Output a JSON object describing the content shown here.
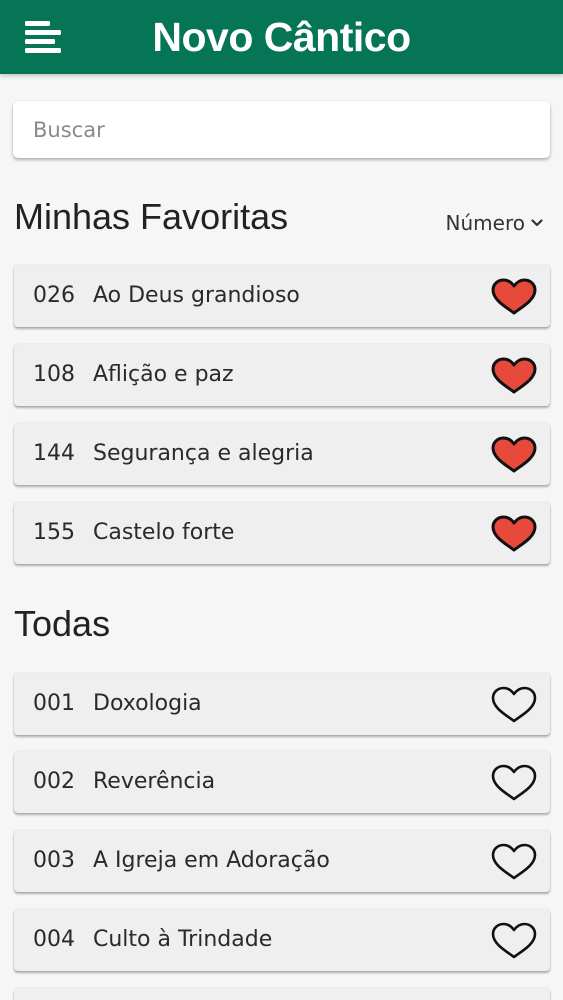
{
  "header": {
    "title": "Novo Cântico",
    "menu_icon": "menu-icon"
  },
  "search": {
    "placeholder": "Buscar",
    "value": ""
  },
  "favorites": {
    "title": "Minhas Favoritas",
    "sort_label": "Número",
    "items": [
      {
        "number": "026",
        "title": "Ao Deus grandioso",
        "favorite": true
      },
      {
        "number": "108",
        "title": "Aflição e paz",
        "favorite": true
      },
      {
        "number": "144",
        "title": "Segurança e alegria",
        "favorite": true
      },
      {
        "number": "155",
        "title": "Castelo forte",
        "favorite": true
      }
    ]
  },
  "all": {
    "title": "Todas",
    "items": [
      {
        "number": "001",
        "title": "Doxologia",
        "favorite": false
      },
      {
        "number": "002",
        "title": "Reverência",
        "favorite": false
      },
      {
        "number": "003",
        "title": "A Igreja em Adoração",
        "favorite": false
      },
      {
        "number": "004",
        "title": "Culto à Trindade",
        "favorite": false
      }
    ]
  },
  "colors": {
    "brand": "#057556",
    "heart_filled": "#e74a3b",
    "heart_outline": "#111111"
  }
}
